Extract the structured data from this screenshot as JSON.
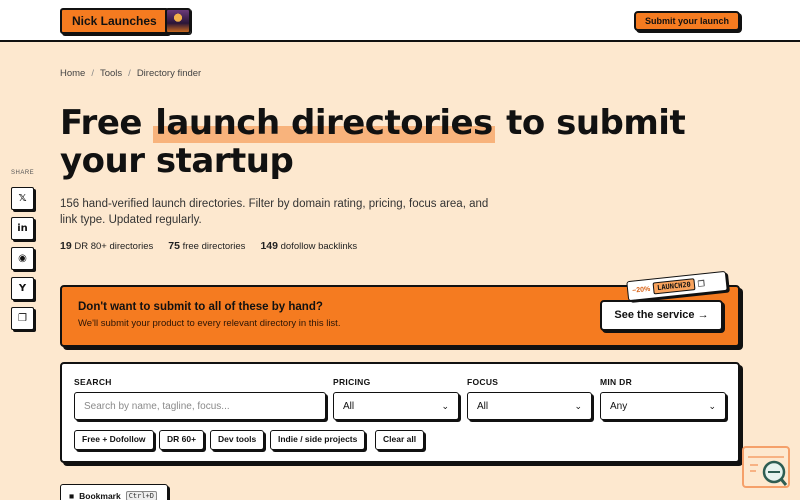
{
  "header": {
    "logo_label": "Nick Launches",
    "avatar_icon": "avatar-image",
    "submit_label": "Submit your launch"
  },
  "breadcrumb": {
    "items": [
      "Home",
      "Tools",
      "Directory finder"
    ],
    "separator": "/"
  },
  "title": {
    "before": "Free ",
    "highlight": "launch directories",
    "after": " to submit your startup"
  },
  "intro": "156 hand-verified launch directories. Filter by domain rating, pricing, focus area, and link type. Updated regularly.",
  "stats": [
    {
      "value": "19",
      "label": "DR 80+ directories"
    },
    {
      "value": "75",
      "label": "free directories"
    },
    {
      "value": "149",
      "label": "dofollow backlinks"
    }
  ],
  "share": {
    "label": "SHARE",
    "buttons": [
      {
        "icon": "x-icon",
        "glyph": "𝕏"
      },
      {
        "icon": "linkedin-icon",
        "glyph": "in"
      },
      {
        "icon": "reddit-icon",
        "glyph": "◉"
      },
      {
        "icon": "hackernews-icon",
        "glyph": "Y"
      },
      {
        "icon": "copy-icon",
        "glyph": "❐"
      }
    ]
  },
  "promo": {
    "title": "Don't want to submit to all of these by hand?",
    "subtitle": "We'll submit your product to every relevant directory in this list.",
    "cta": "See the service →",
    "coupon_discount": "−20%",
    "coupon_code": "LAUNCH20"
  },
  "filters": {
    "search_label": "SEARCH",
    "search_placeholder": "Search by name, tagline, focus...",
    "pricing_label": "PRICING",
    "pricing_value": "All",
    "focus_label": "FOCUS",
    "focus_value": "All",
    "mindr_label": "MIN DR",
    "mindr_value": "Any",
    "chips": [
      "Free + Dofollow",
      "DR 60+",
      "Dev tools",
      "Indie / side projects",
      "Clear all"
    ]
  },
  "bookmark": {
    "label": "Bookmark",
    "shortcut": "Ctrl+D"
  },
  "colors": {
    "background": "#fde8cf",
    "accent": "#f57b20",
    "highlight": "#f8b37c",
    "border": "#111111"
  }
}
